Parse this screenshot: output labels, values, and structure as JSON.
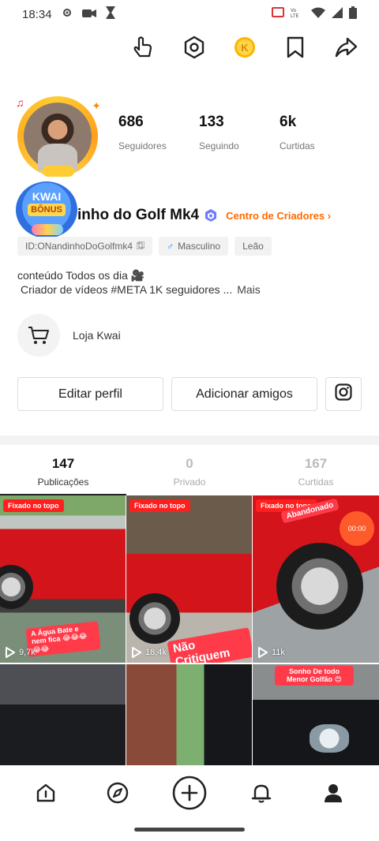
{
  "status_bar": {
    "time": "18:34"
  },
  "profile": {
    "followers": {
      "count": "686",
      "label": "Seguidores"
    },
    "following": {
      "count": "133",
      "label": "Seguindo"
    },
    "likes": {
      "count": "6k",
      "label": "Curtidas"
    },
    "bonus_badge": {
      "line1": "KWAI",
      "line2": "BÔNUS"
    },
    "name": "inho do Golf Mk4",
    "creator_link": "Centro de Criadores",
    "tags": [
      "ID:ONandinhoDoGolfmk4",
      "Masculino",
      "Leão"
    ],
    "bio_line1": "conteúdo Todos os dia 🎥",
    "bio_line2": "Criador de vídeos #META 1K seguidores ...",
    "bio_more": "Mais",
    "shop_label": "Loja Kwai",
    "edit_button": "Editar perfil",
    "add_button": "Adicionar amigos"
  },
  "tabs": [
    {
      "count": "147",
      "label": "Publicações"
    },
    {
      "count": "0",
      "label": "Privado"
    },
    {
      "count": "167",
      "label": "Curtidas"
    }
  ],
  "grid": {
    "pinned_label": "Fixado no topo",
    "items": [
      {
        "views": "9,7k",
        "caption": "A Água Bate e nem fica 😂😂😂😂😂"
      },
      {
        "views": "18,4k",
        "caption": "Não Critiquem"
      },
      {
        "views": "11k",
        "caption": "Abandonado",
        "timer": "00:00"
      },
      {
        "caption": ""
      },
      {
        "caption": ""
      },
      {
        "caption": "Sonho De todo Menor Golfão 😍"
      }
    ]
  },
  "icons": {
    "top": [
      "gesture-icon",
      "settings-icon",
      "coin-icon",
      "bookmark-icon",
      "share-icon"
    ],
    "nav": [
      "home-icon",
      "discover-icon",
      "create-icon",
      "notifications-icon",
      "profile-icon"
    ]
  },
  "colors": {
    "accent": "#ff6a00",
    "pin_red": "#ff1f1f",
    "verified": "#6b7cff"
  }
}
